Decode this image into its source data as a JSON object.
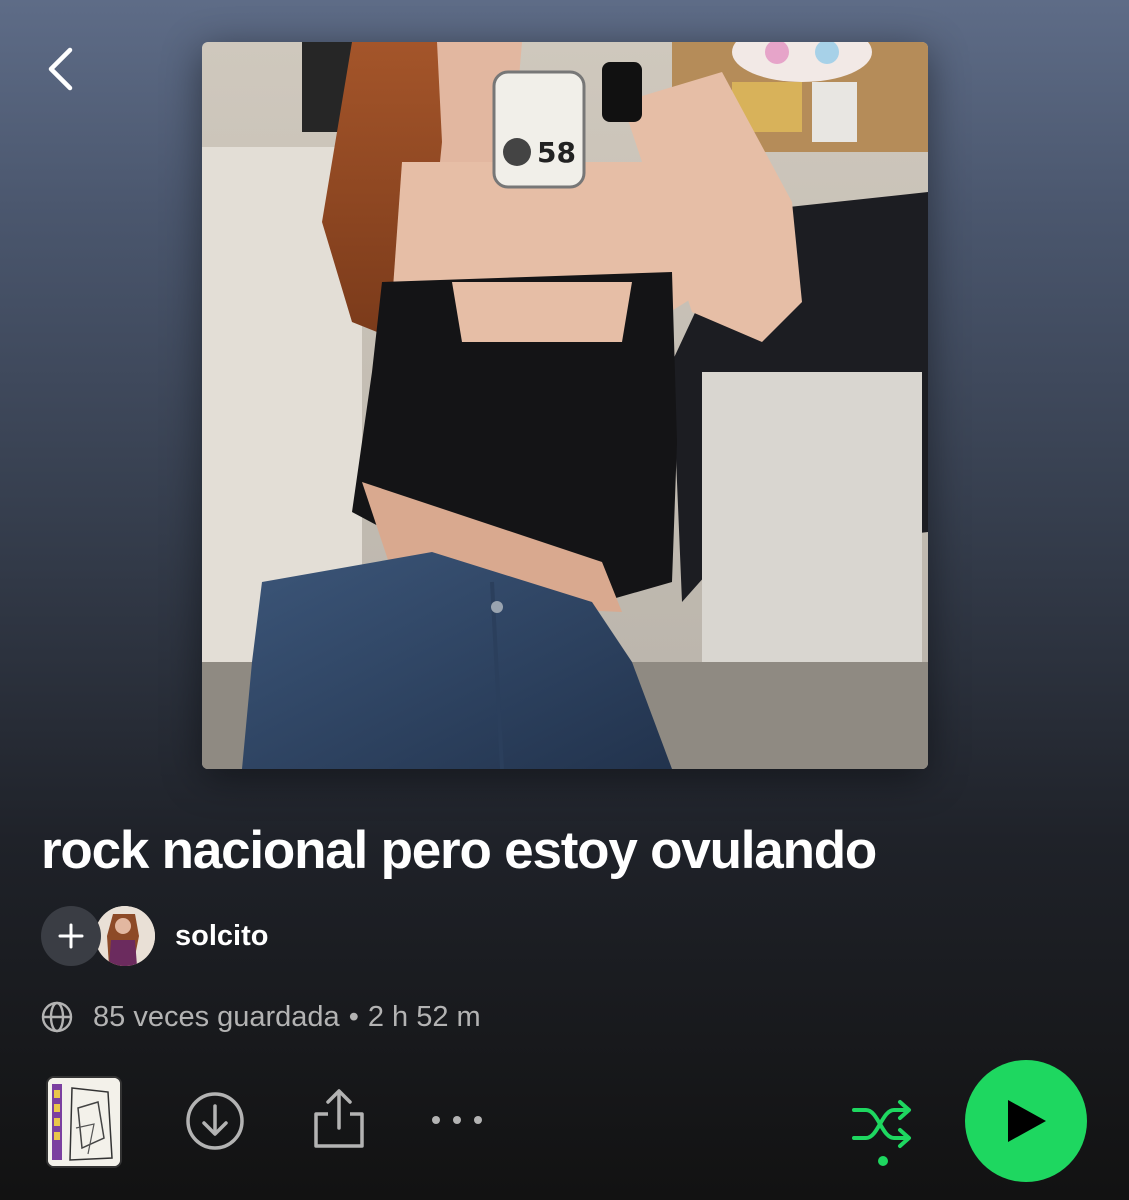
{
  "header": {
    "back_icon": "chevron-left-icon"
  },
  "playlist": {
    "title": "rock nacional pero estoy ovulando",
    "owner": "solcito",
    "saves": "85 veces guardada",
    "separator": "•",
    "duration": "2 h 52 m",
    "visibility_icon": "globe-icon"
  },
  "actions": {
    "add_collaborator_icon": "plus-icon",
    "download_icon": "download-icon",
    "share_icon": "share-icon",
    "more_icon": "more-options-icon",
    "shuffle_icon": "shuffle-icon",
    "play_icon": "play-icon"
  },
  "colors": {
    "accent_green": "#1ed760",
    "background_top": "#5e6c87",
    "background_bottom": "#121212",
    "secondary_text": "#b3b3b3"
  }
}
